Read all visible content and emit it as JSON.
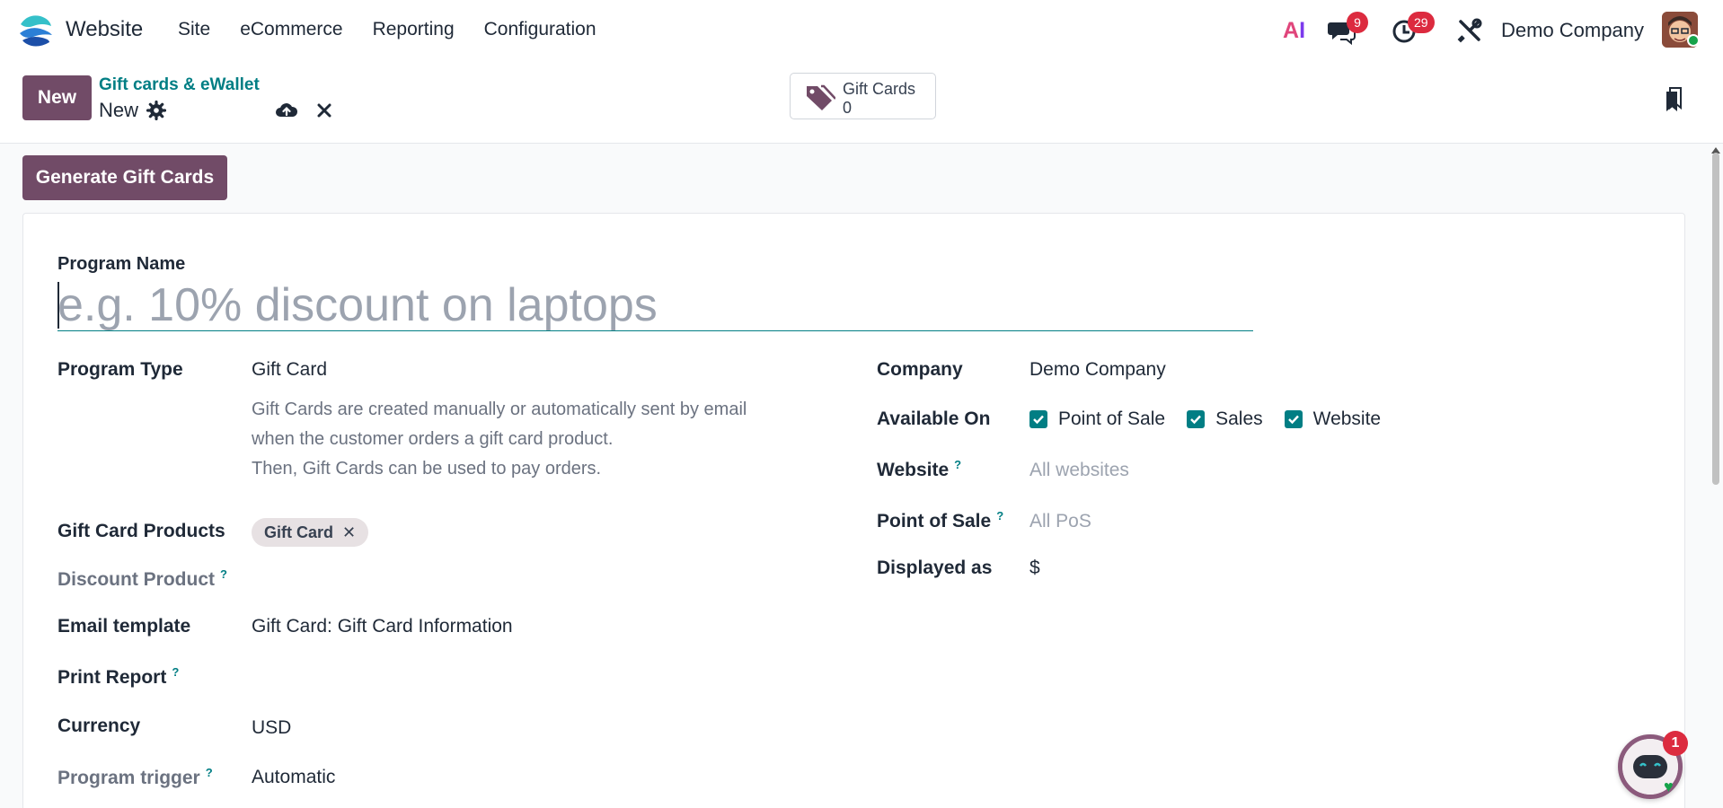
{
  "navbar": {
    "app_name": "Website",
    "menu": [
      "Site",
      "eCommerce",
      "Reporting",
      "Configuration"
    ],
    "ai_label": "AI",
    "messages_badge": "9",
    "activities_badge": "29",
    "company": "Demo Company"
  },
  "control": {
    "new_label": "New",
    "breadcrumb": "Gift cards & eWallet",
    "record_name": "New",
    "smart_button": {
      "label": "Gift Cards",
      "value": "0"
    }
  },
  "actions": {
    "generate_label": "Generate Gift Cards"
  },
  "form": {
    "program_name_label": "Program Name",
    "program_name_placeholder": "e.g. 10% discount on laptops",
    "program_type_label": "Program Type",
    "program_type_value": "Gift Card",
    "program_type_help": [
      "Gift Cards are created manually or automatically sent by email",
      "when the customer orders a gift card product.",
      "Then, Gift Cards can be used to pay orders."
    ],
    "gift_card_products_label": "Gift Card Products",
    "gift_card_products_tag": "Gift Card",
    "discount_product_label": "Discount Product",
    "email_template_label": "Email template",
    "email_template_value": "Gift Card: Gift Card Information",
    "print_report_label": "Print Report",
    "currency_label": "Currency",
    "currency_value": "USD",
    "program_trigger_label": "Program trigger",
    "program_trigger_value": "Automatic",
    "help_mark": "?",
    "company_label": "Company",
    "company_value": "Demo Company",
    "available_on_label": "Available On",
    "available_on": [
      {
        "label": "Point of Sale",
        "checked": true
      },
      {
        "label": "Sales",
        "checked": true
      },
      {
        "label": "Website",
        "checked": true
      }
    ],
    "website_label": "Website",
    "website_placeholder": "All websites",
    "pos_label": "Point of Sale",
    "pos_placeholder": "All PoS",
    "displayed_as_label": "Displayed as",
    "displayed_as_value": "$"
  },
  "chat": {
    "badge": "1"
  },
  "colors": {
    "brand": "#714b67",
    "accent": "#017e84",
    "badge": "#dc2b3f"
  }
}
